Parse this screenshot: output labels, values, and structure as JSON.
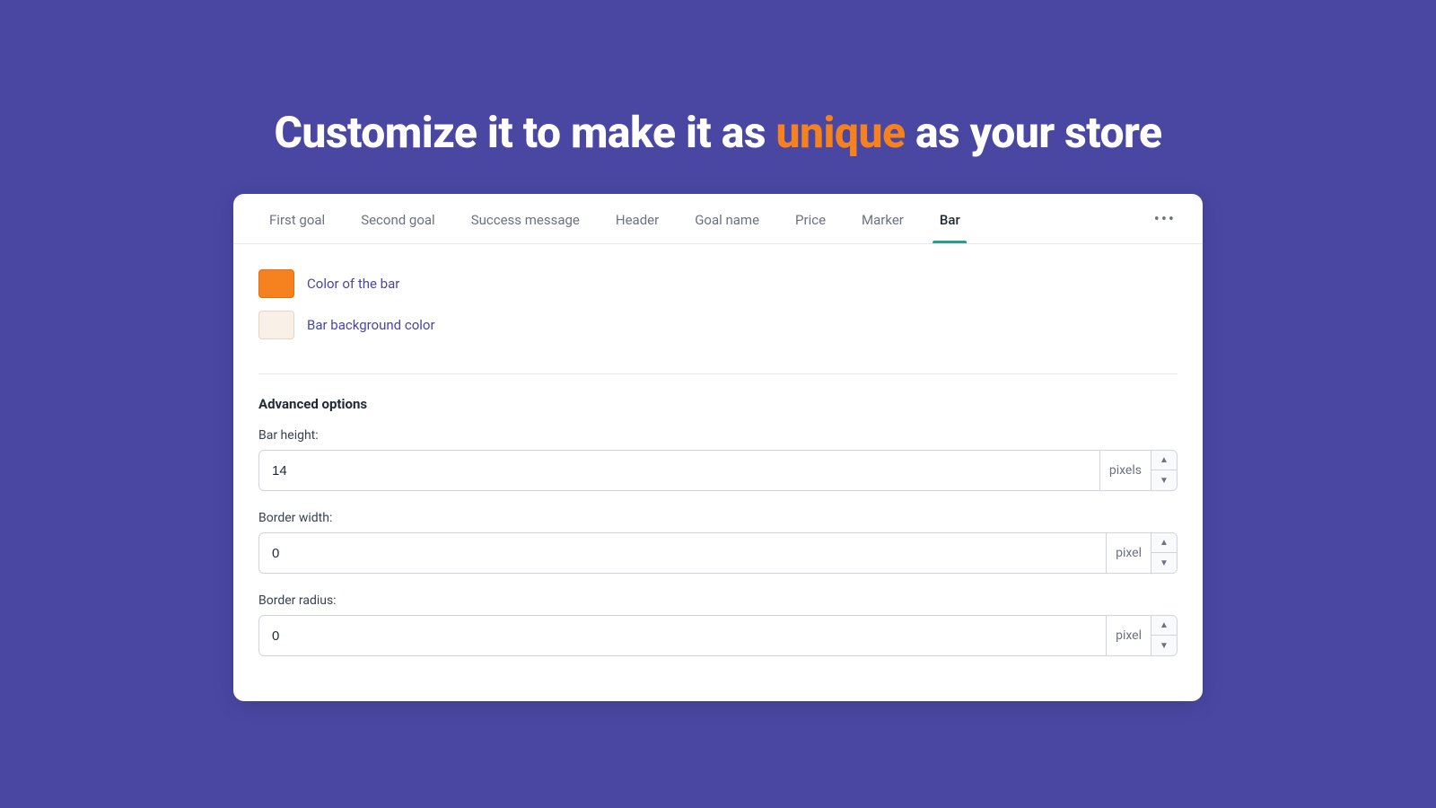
{
  "headline": {
    "prefix": "Customize it to make it as ",
    "highlight": "unique",
    "suffix": " as your store"
  },
  "tabs": {
    "items": [
      {
        "label": "First goal",
        "active": false
      },
      {
        "label": "Second goal",
        "active": false
      },
      {
        "label": "Success message",
        "active": false
      },
      {
        "label": "Header",
        "active": false
      },
      {
        "label": "Goal name",
        "active": false
      },
      {
        "label": "Price",
        "active": false
      },
      {
        "label": "Marker",
        "active": false
      },
      {
        "label": "Bar",
        "active": true
      }
    ],
    "more_label": "•••"
  },
  "color_section": {
    "bar_color_label": "Color of the bar",
    "bg_color_label": "Bar background color"
  },
  "advanced": {
    "title": "Advanced options",
    "bar_height": {
      "label": "Bar height:",
      "value": "14",
      "unit": "pixels"
    },
    "border_width": {
      "label": "Border width:",
      "value": "0",
      "unit": "pixel"
    },
    "border_radius": {
      "label": "Border radius:",
      "value": "0",
      "unit": "pixel"
    }
  }
}
